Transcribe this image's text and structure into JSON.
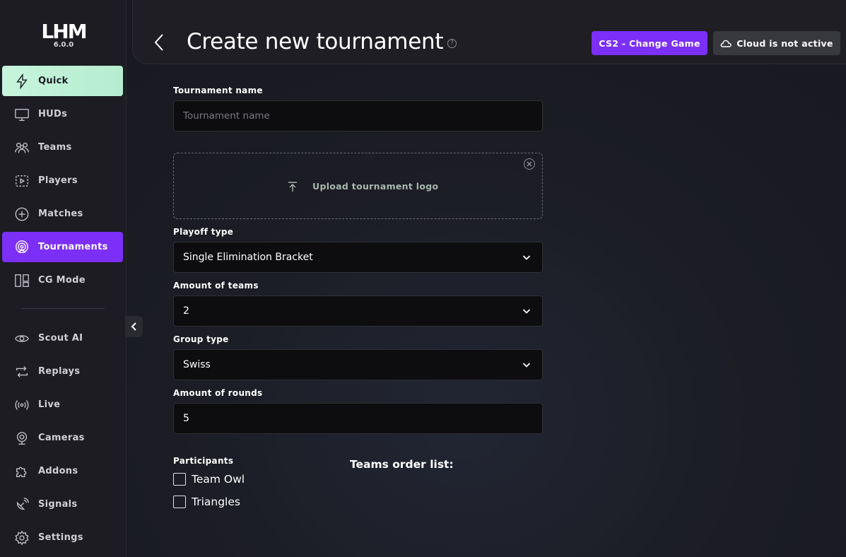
{
  "app": {
    "logo_text": "LHM",
    "version": "6.0.0"
  },
  "sidebar": {
    "items": [
      {
        "label": "Quick",
        "icon": "bolt-icon"
      },
      {
        "label": "HUDs",
        "icon": "monitor-icon"
      },
      {
        "label": "Teams",
        "icon": "users-icon"
      },
      {
        "label": "Players",
        "icon": "player-card-icon"
      },
      {
        "label": "Matches",
        "icon": "plus-circle-icon"
      },
      {
        "label": "Tournaments",
        "icon": "tournament-target-icon"
      },
      {
        "label": "CG Mode",
        "icon": "layout-icon"
      },
      {
        "label": "Scout AI",
        "icon": "eye-icon"
      },
      {
        "label": "Replays",
        "icon": "replay-icon"
      },
      {
        "label": "Live",
        "icon": "broadcast-icon"
      },
      {
        "label": "Cameras",
        "icon": "webcam-icon"
      },
      {
        "label": "Addons",
        "icon": "puzzle-icon"
      },
      {
        "label": "Signals",
        "icon": "satellite-icon"
      },
      {
        "label": "Settings",
        "icon": "gear-icon"
      }
    ],
    "active_quick": "Quick",
    "active_section": "Tournaments"
  },
  "header": {
    "title": "Create new tournament",
    "game_button": "CS2 - Change Game",
    "cloud_button": "Cloud is not active"
  },
  "form": {
    "name_label": "Tournament name",
    "name_placeholder": "Tournament name",
    "name_value": "",
    "upload_label": "Upload tournament logo",
    "playoff_label": "Playoff type",
    "playoff_value": "Single Elimination Bracket",
    "teams_amount_label": "Amount of teams",
    "teams_amount_value": "2",
    "group_label": "Group type",
    "group_value": "Swiss",
    "rounds_label": "Amount of rounds",
    "rounds_value": "5",
    "participants_label": "Participants",
    "participants": [
      {
        "name": "Team Owl",
        "checked": false
      },
      {
        "name": "Triangles",
        "checked": false
      }
    ],
    "order_list_title": "Teams order list:"
  },
  "colors": {
    "accent_purple": "#7b2ff7",
    "quick_green": "#c6f5dc",
    "background": "#1b1c24"
  }
}
